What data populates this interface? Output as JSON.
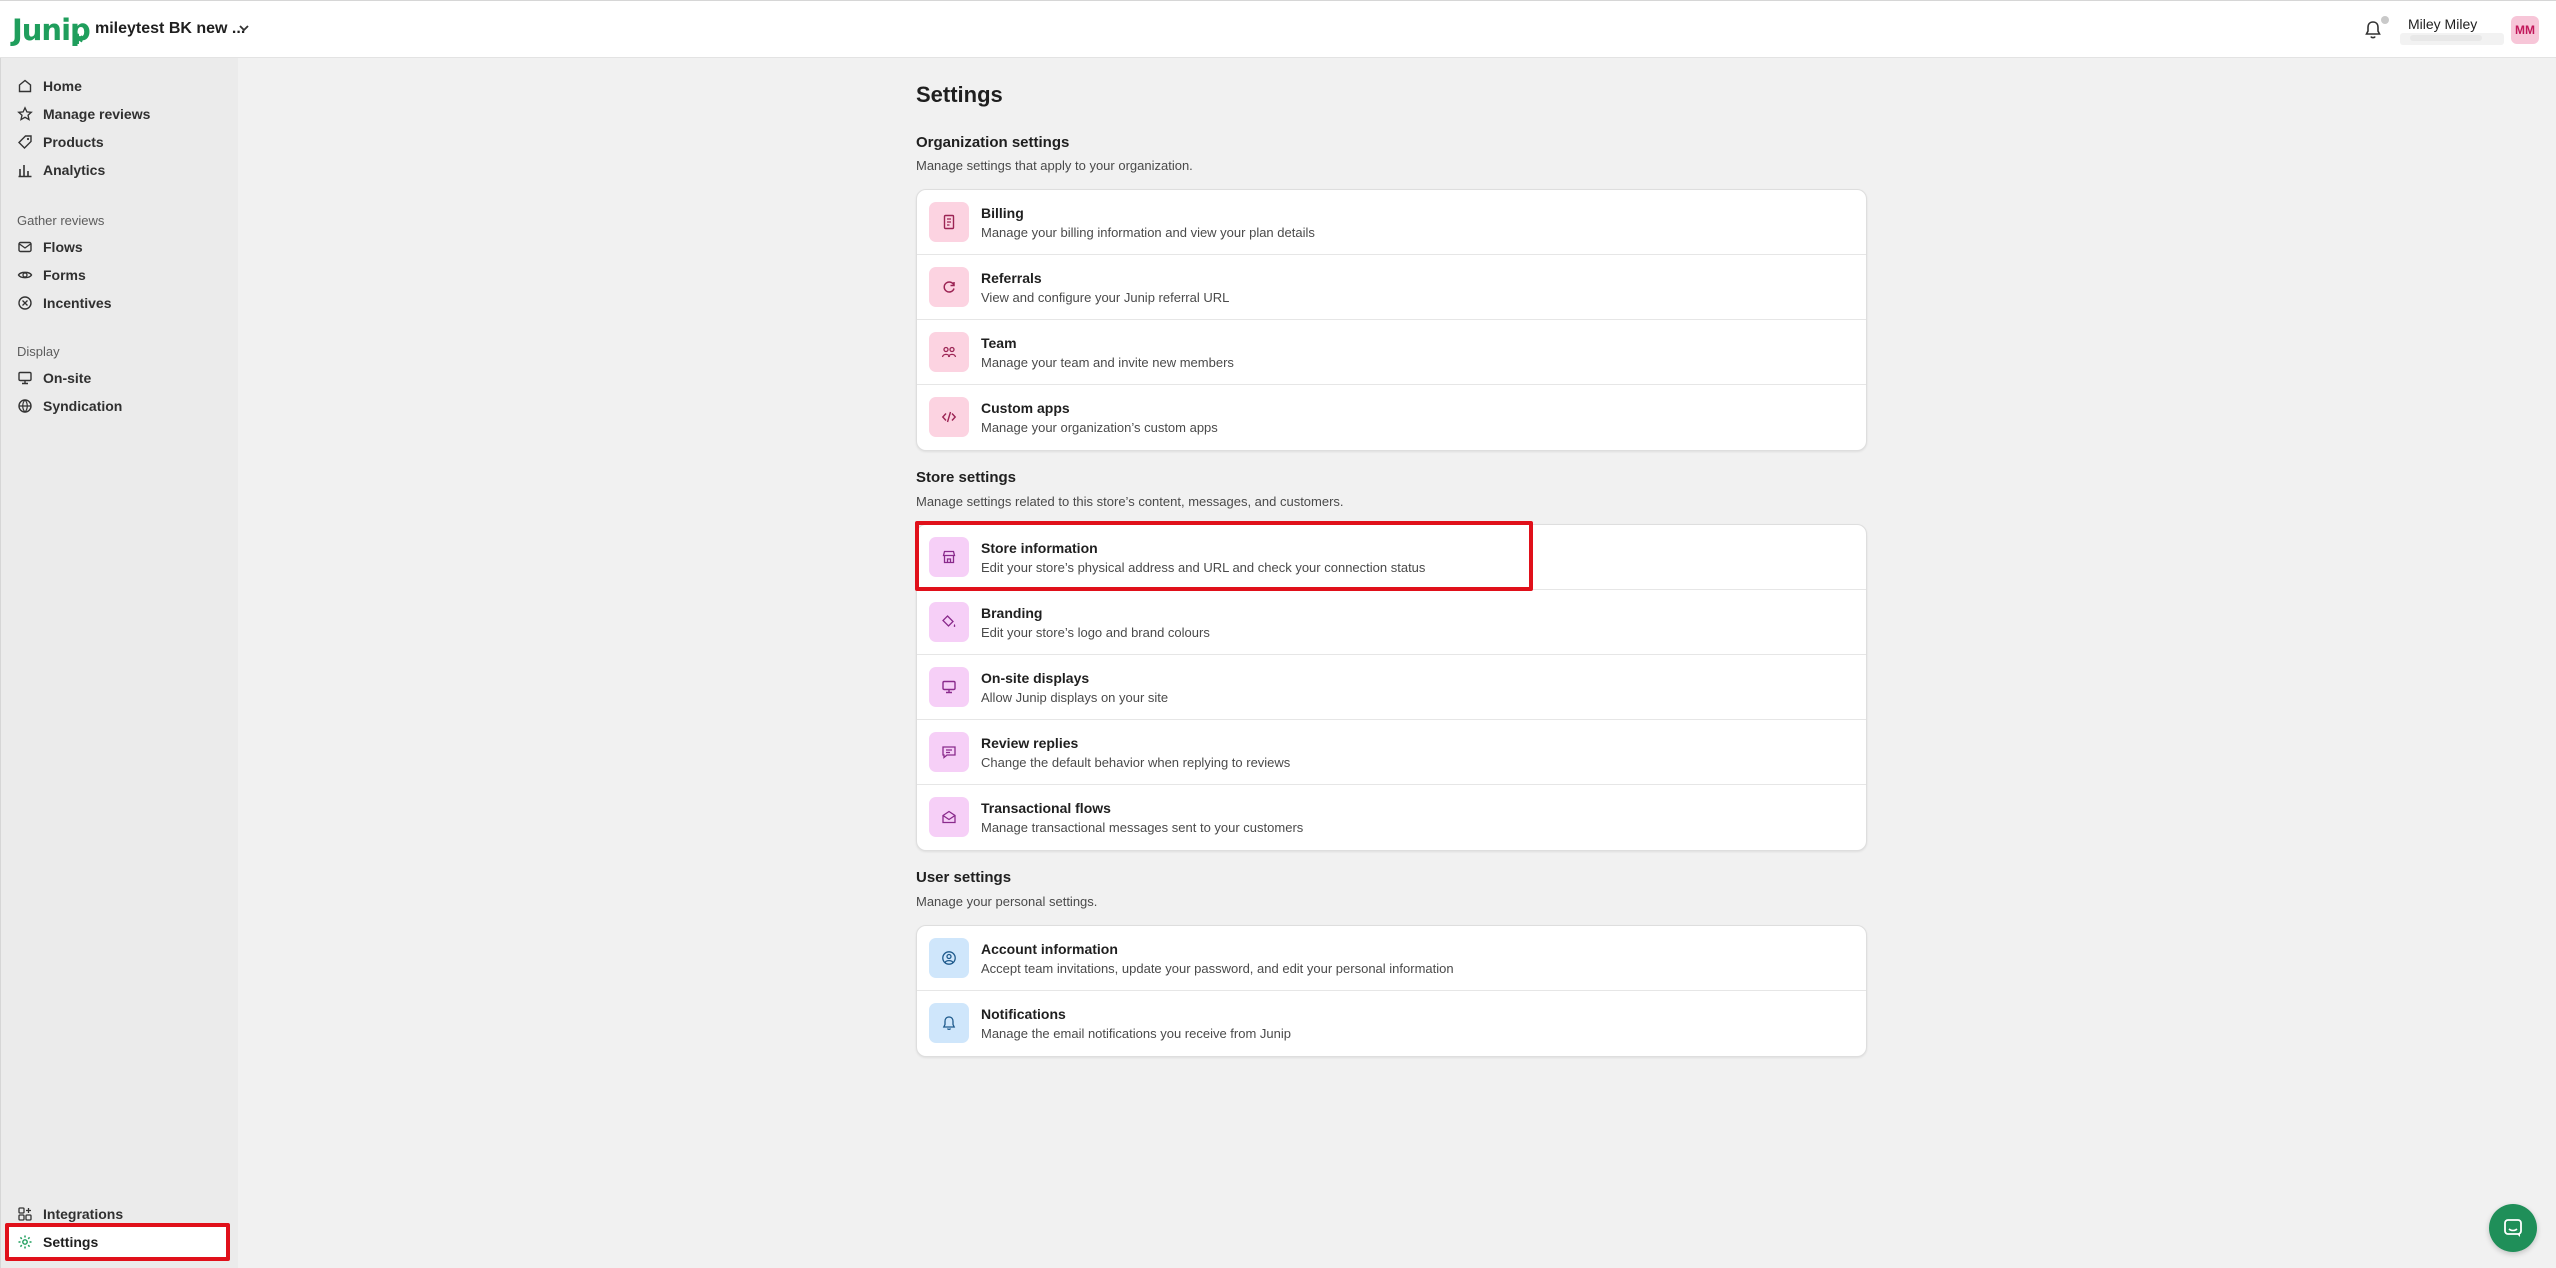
{
  "header": {
    "logo_text": "Junip",
    "store_name": "mileytest BK new ...",
    "user_name": "Miley Miley",
    "avatar_initials": "MM"
  },
  "sidebar": {
    "items_main": [
      {
        "label": "Home",
        "icon": "home-icon"
      },
      {
        "label": "Manage reviews",
        "icon": "star-icon"
      },
      {
        "label": "Products",
        "icon": "tag-icon"
      },
      {
        "label": "Analytics",
        "icon": "bar-chart-icon"
      }
    ],
    "gather_title": "Gather reviews",
    "items_gather": [
      {
        "label": "Flows",
        "icon": "mail-icon"
      },
      {
        "label": "Forms",
        "icon": "eye-icon"
      },
      {
        "label": "Incentives",
        "icon": "incentive-icon"
      }
    ],
    "display_title": "Display",
    "items_display": [
      {
        "label": "On-site",
        "icon": "monitor-icon"
      },
      {
        "label": "Syndication",
        "icon": "globe-icon"
      }
    ],
    "items_bottom": [
      {
        "label": "Integrations",
        "icon": "apps-icon"
      },
      {
        "label": "Settings",
        "icon": "gear-icon"
      }
    ]
  },
  "main": {
    "title": "Settings",
    "org": {
      "title": "Organization settings",
      "desc": "Manage settings that apply to your organization.",
      "rows": [
        {
          "title": "Billing",
          "desc": "Manage your billing information and view your plan details",
          "icon": "receipt-icon"
        },
        {
          "title": "Referrals",
          "desc": "View and configure your Junip referral URL",
          "icon": "refresh-icon"
        },
        {
          "title": "Team",
          "desc": "Manage your team and invite new members",
          "icon": "people-icon"
        },
        {
          "title": "Custom apps",
          "desc": "Manage your organization’s custom apps",
          "icon": "code-icon"
        }
      ]
    },
    "store": {
      "title": "Store settings",
      "desc": "Manage settings related to this store’s content, messages, and customers.",
      "rows": [
        {
          "title": "Store information",
          "desc": "Edit your store’s physical address and URL and check your connection status",
          "icon": "store-icon"
        },
        {
          "title": "Branding",
          "desc": "Edit your store’s logo and brand colours",
          "icon": "paint-bucket-icon"
        },
        {
          "title": "On-site displays",
          "desc": "Allow Junip displays on your site",
          "icon": "monitor-icon"
        },
        {
          "title": "Review replies",
          "desc": "Change the default behavior when replying to reviews",
          "icon": "chat-icon"
        },
        {
          "title": "Transactional flows",
          "desc": "Manage transactional messages sent to your customers",
          "icon": "envelope-open-icon"
        }
      ]
    },
    "user": {
      "title": "User settings",
      "desc": "Manage your personal settings.",
      "rows": [
        {
          "title": "Account information",
          "desc": "Accept team invitations, update your password, and edit your personal information",
          "icon": "user-circle-icon"
        },
        {
          "title": "Notifications",
          "desc": "Manage the email notifications you receive from Junip",
          "icon": "bell-icon"
        }
      ]
    }
  },
  "colors": {
    "brand_green": "#1f9e5c",
    "highlight_red": "#e0101a",
    "pink_icon_bg": "#fcd3e1",
    "violet_icon_bg": "#f6cff7",
    "blue_icon_bg": "#cfe6fb"
  }
}
